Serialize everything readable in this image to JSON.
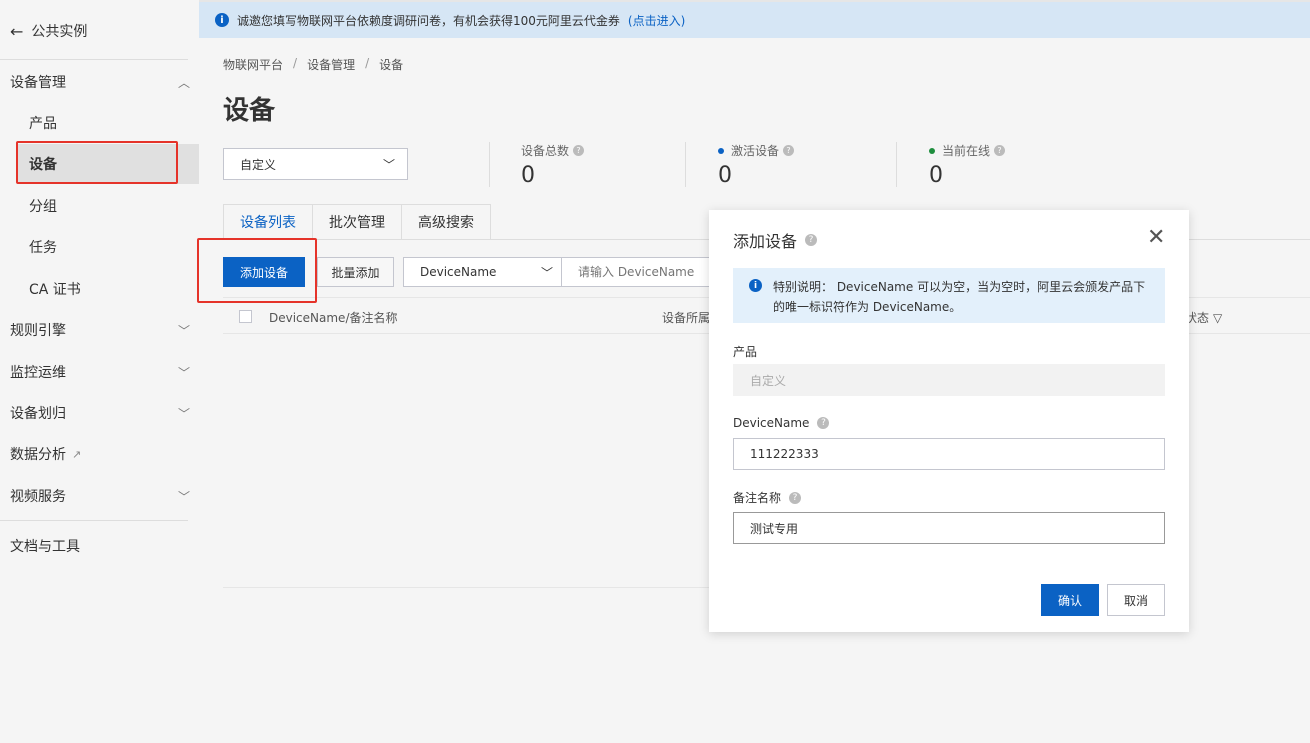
{
  "sidebar": {
    "back_label": "公共实例",
    "groups": {
      "device_mgmt": "设备管理",
      "rules": "规则引擎",
      "monitor": "监控运维",
      "assign": "设备划归",
      "analysis": "数据分析",
      "video": "视频服务",
      "docs": "文档与工具"
    },
    "items": {
      "product": "产品",
      "device": "设备",
      "group": "分组",
      "task": "任务",
      "ca": "CA 证书"
    }
  },
  "banner": {
    "text": "诚邀您填写物联网平台依赖度调研问卷，有机会获得100元阿里云代金券",
    "link": "(点击进入)"
  },
  "breadcrumb": [
    "物联网平台",
    "设备管理",
    "设备"
  ],
  "page_title": "设备",
  "product_select": {
    "value": "自定义"
  },
  "stats": [
    {
      "label": "设备总数",
      "value": "0"
    },
    {
      "label": "激活设备",
      "value": "0",
      "dot_color": "#0b62c4"
    },
    {
      "label": "当前在线",
      "value": "0",
      "dot_color": "#1e8e3e"
    }
  ],
  "tabs": [
    "设备列表",
    "批次管理",
    "高级搜索"
  ],
  "toolbar": {
    "add_label": "添加设备",
    "batch_label": "批量添加",
    "filter_value": "DeviceName",
    "search_placeholder": "请输入 DeviceName"
  },
  "table": {
    "columns": [
      "DeviceName/备注名称",
      "设备所属",
      "状态"
    ]
  },
  "dialog": {
    "title": "添加设备",
    "notice": "特别说明： DeviceName 可以为空，当为空时，阿里云会颁发产品下的唯一标识符作为 DeviceName。",
    "product_label": "产品",
    "product_value": "自定义",
    "devicename_label": "DeviceName",
    "devicename_value": "111222333",
    "remark_label": "备注名称",
    "remark_value": "测试专用",
    "ok_label": "确认",
    "cancel_label": "取消"
  },
  "colors": {
    "primary": "#0b62c4",
    "highlight_red": "#e5332a",
    "accent_orange": "#ff6a00"
  }
}
